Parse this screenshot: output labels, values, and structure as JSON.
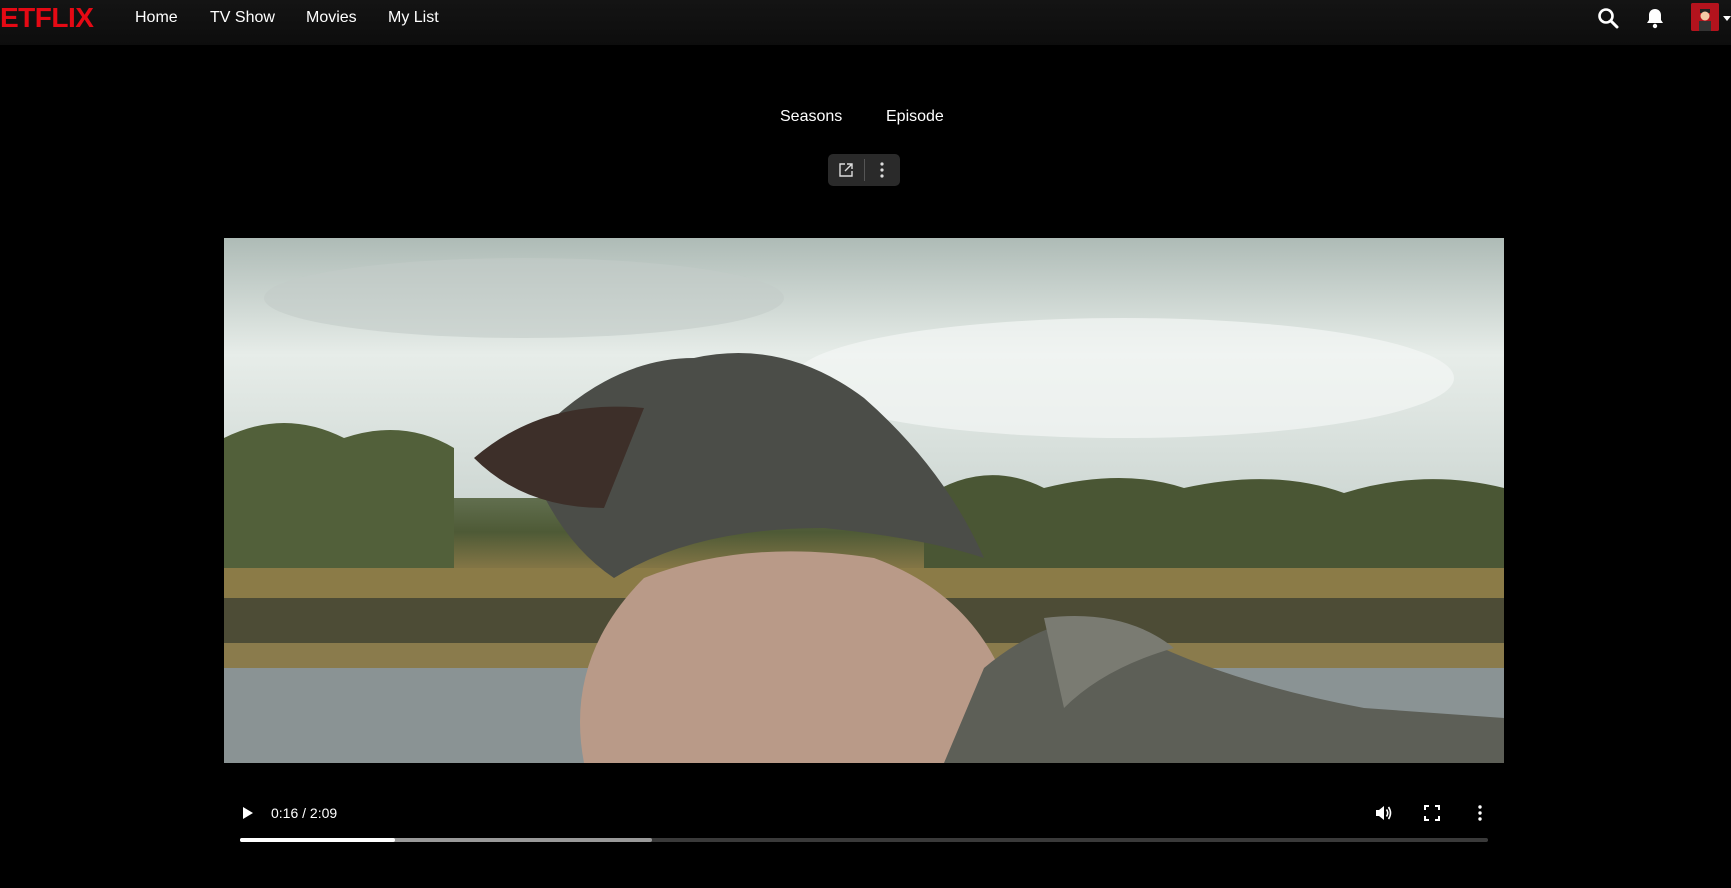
{
  "brand": {
    "logo_text": "ETFLIX",
    "accent": "#e50914"
  },
  "nav": {
    "links": [
      {
        "label": "Home"
      },
      {
        "label": "TV Show"
      },
      {
        "label": "Movies"
      },
      {
        "label": "My List"
      }
    ],
    "icons": [
      "search-icon",
      "bell-icon",
      "avatar"
    ]
  },
  "tabs": [
    {
      "label": "Seasons"
    },
    {
      "label": "Episode"
    }
  ],
  "mini_toolbar": {
    "icons": [
      "open-external-icon",
      "more-vertical-icon"
    ]
  },
  "video": {
    "time_display": "0:16 / 2:09",
    "played_fraction": 0.124,
    "buffered_fraction": 0.33,
    "control_icons": [
      "play-icon",
      "volume-icon",
      "fullscreen-icon",
      "more-vertical-icon"
    ]
  }
}
